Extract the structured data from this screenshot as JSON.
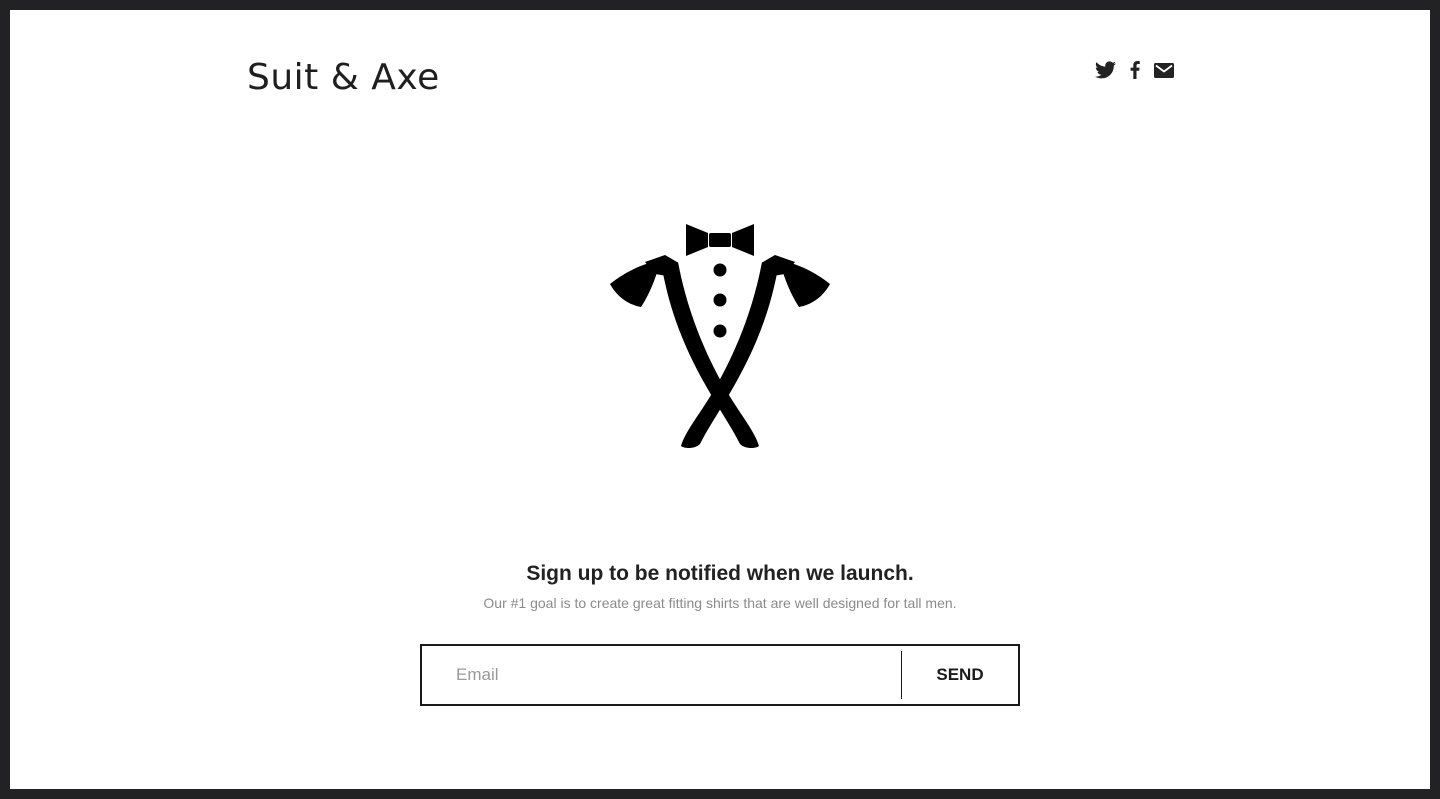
{
  "brand": {
    "name": "Suit & Axe",
    "logo_icon": "crossed-axes-tuxedo-icon"
  },
  "social": [
    {
      "name": "twitter",
      "icon": "twitter-icon"
    },
    {
      "name": "facebook",
      "icon": "facebook-icon"
    },
    {
      "name": "email",
      "icon": "mail-icon"
    }
  ],
  "signup": {
    "title": "Sign up to be notified when we launch.",
    "subtitle": "Our #1 goal is to create great fitting shirts that are well designed for tall men.",
    "email_placeholder": "Email",
    "email_value": "",
    "send_label": "SEND"
  },
  "colors": {
    "page_border": "#222224",
    "background": "#ffffff",
    "text_dark": "#222222",
    "text_muted": "#8b8b8b"
  }
}
